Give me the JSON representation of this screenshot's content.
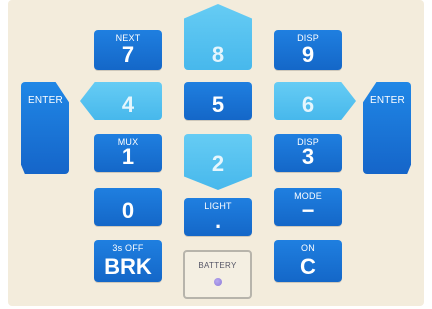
{
  "keypad": {
    "keys": {
      "k8": {
        "sub": "",
        "main": "8"
      },
      "k7": {
        "sub": "NEXT",
        "main": "7"
      },
      "k9": {
        "sub": "DISP",
        "main": "9"
      },
      "k4": {
        "sub": "",
        "main": "4"
      },
      "k5": {
        "sub": "",
        "main": "5"
      },
      "k6": {
        "sub": "",
        "main": "6"
      },
      "k1": {
        "sub": "MUX",
        "main": "1"
      },
      "k2": {
        "sub": "",
        "main": "2"
      },
      "k3": {
        "sub": "DISP",
        "main": "3"
      },
      "k0": {
        "sub": "",
        "main": "0"
      },
      "dot": {
        "sub": "LIGHT",
        "main": "."
      },
      "minus": {
        "sub": "MODE",
        "main": "−"
      },
      "brk": {
        "sub": "3s OFF",
        "main": "BRK"
      },
      "c": {
        "sub": "ON",
        "main": "C"
      }
    },
    "enter_left": "ENTER",
    "enter_right": "ENTER",
    "battery_label": "BATTERY"
  },
  "colors": {
    "panel": "#f3ecdc",
    "dark_key": "#1a72d6",
    "light_key": "#55c1f0",
    "battery_led": "#9d8ce0"
  }
}
